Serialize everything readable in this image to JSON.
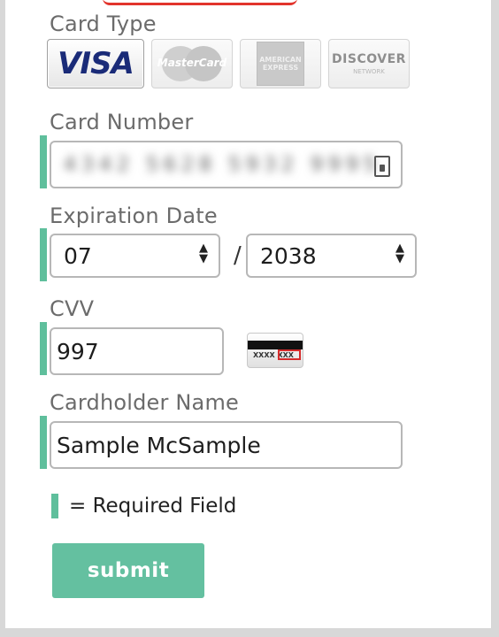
{
  "form": {
    "card_type_label": "Card Type",
    "card_types": {
      "visa": "VISA",
      "mastercard": "MasterCard",
      "amex": "AMERICAN EXPRESS",
      "discover": "DISCOVER",
      "discover_sub": "NETWORK"
    },
    "card_number_label": "Card Number",
    "card_number_value": "4342 5628 5932 9995",
    "expiration_label": "Expiration Date",
    "exp_month": "07",
    "exp_separator": "/",
    "exp_year": "2038",
    "cvv_label": "CVV",
    "cvv_value": "997",
    "cvv_hint_digits": "XXXX XXX",
    "cardholder_label": "Cardholder Name",
    "cardholder_value": "Sample McSample",
    "required_legend": "= Required Field",
    "submit_label": "submit"
  },
  "colors": {
    "required_accent": "#5fbf9c",
    "submit_bg": "#64c0a0",
    "top_accent": "#e2342c"
  }
}
